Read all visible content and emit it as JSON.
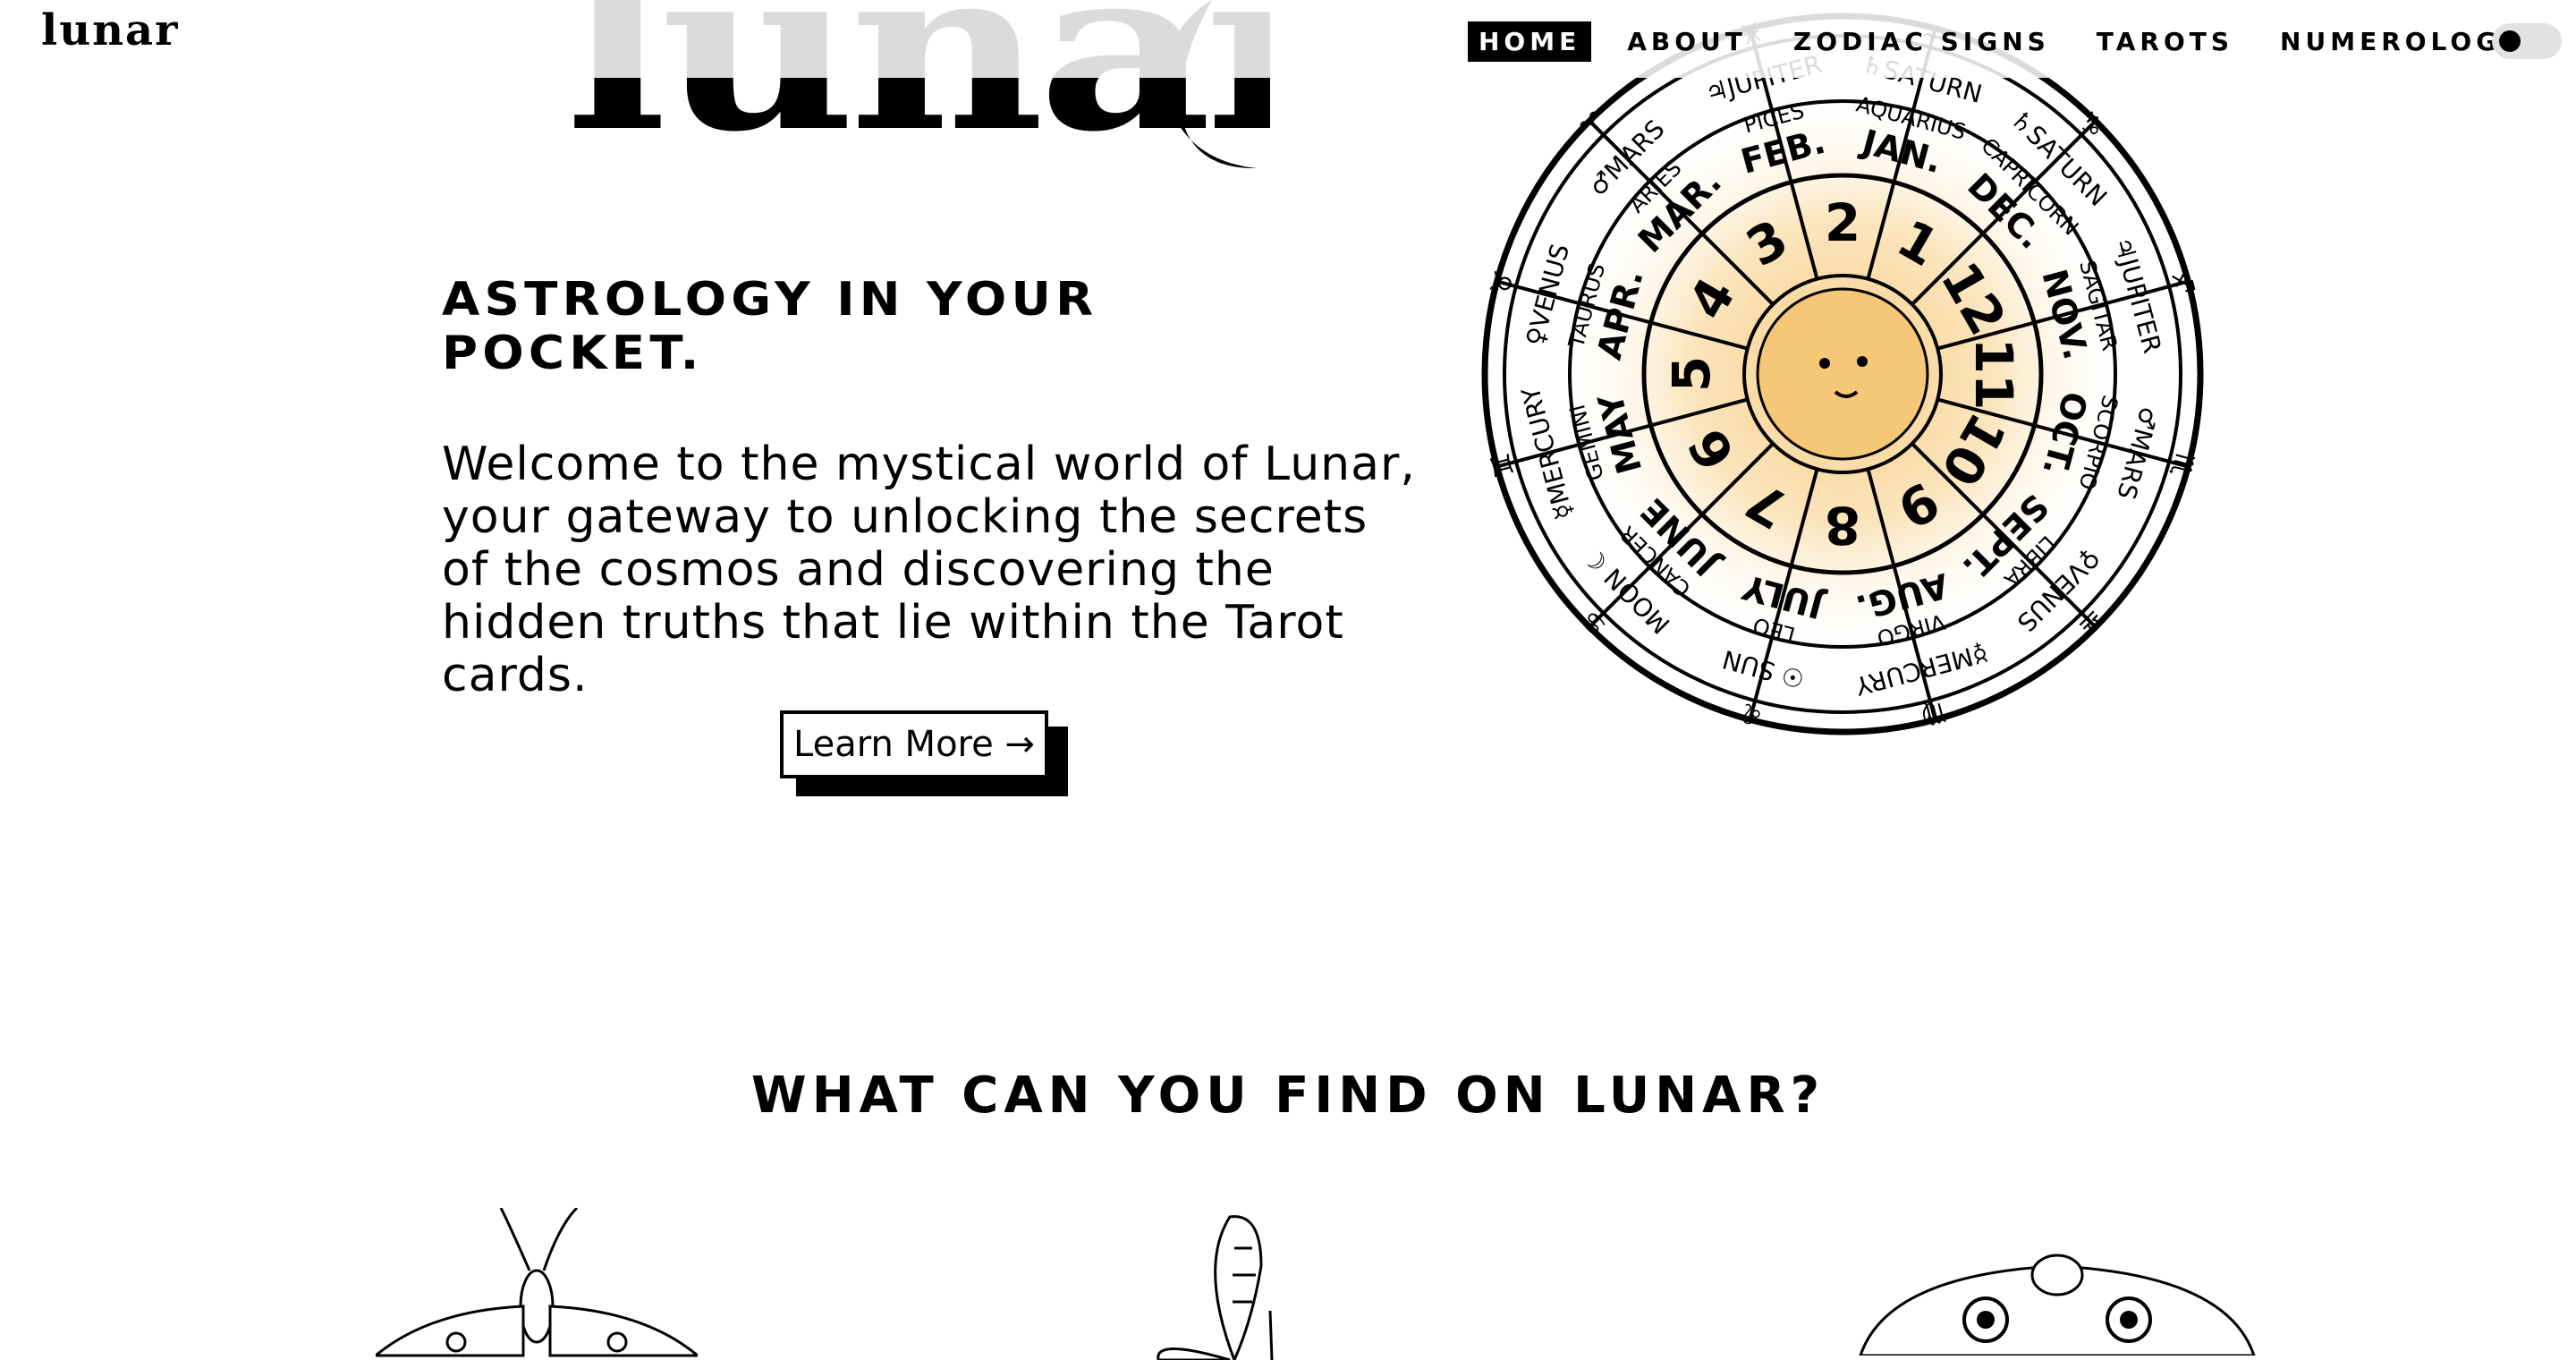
{
  "nav": {
    "logo": "lunar",
    "links": [
      {
        "label": "HOME",
        "active": true
      },
      {
        "label": "ABOUT",
        "active": false
      },
      {
        "label": "ZODIAC SIGNS",
        "active": false
      },
      {
        "label": "TAROTS",
        "active": false
      },
      {
        "label": "NUMEROLOGY",
        "active": false
      }
    ],
    "theme_toggle_icon": "toggle-switch-icon"
  },
  "hero": {
    "title": "lunar",
    "moon_icon": "crescent-moon-icon",
    "tagline": "ASTROLOGY IN YOUR POCKET.",
    "intro": "Welcome to the mystical world of Lunar, your gateway to unlocking the secrets of the cosmos and discovering the hidden truths that lie within the Tarot cards.",
    "button_label": "Learn More →",
    "wheel_image": "zodiac-wheel-illustration",
    "wheel": {
      "center_icon": "sun-face-icon",
      "months": [
        "JAN.",
        "FEB.",
        "MAR.",
        "APR.",
        "MAY",
        "JUNE",
        "JULY",
        "AUG.",
        "SEPT.",
        "OCT.",
        "NOV.",
        "DEC."
      ],
      "signs": [
        "AQUARIUS",
        "PICES",
        "ARIES",
        "TAURUS",
        "GEMINI",
        "CANCER",
        "LEO",
        "VIRGO",
        "LIBRA",
        "SCORPIO",
        "SAGITAR",
        "CAPRICORN"
      ],
      "planets": [
        "♄SATURN",
        "♃JUPITER",
        "♂MARS",
        "♀VENUS",
        "☿MERCURY",
        "MOON ☾",
        "☉ SUN",
        "☿MERCURY",
        "♀VENUS",
        "♂MARS",
        "♃JUPITER",
        "♄SATURN"
      ],
      "numbers": [
        "1",
        "2",
        "3",
        "4",
        "5",
        "6",
        "7",
        "8",
        "9",
        "10",
        "11",
        "12"
      ],
      "glyphs": [
        "♒",
        "♓",
        "♈",
        "♉",
        "♊",
        "♋",
        "♌",
        "♍",
        "♎",
        "♏",
        "♐",
        "♑"
      ]
    }
  },
  "section": {
    "title": "WHAT CAN YOU FIND ON LUNAR?",
    "features": [
      {
        "image": "moth-illustration"
      },
      {
        "image": "butterfly-illustration"
      },
      {
        "image": "moth-illustration-2"
      }
    ]
  },
  "colors": {
    "accent": "#000000",
    "sun": "#f5c777",
    "background": "#ffffff"
  }
}
